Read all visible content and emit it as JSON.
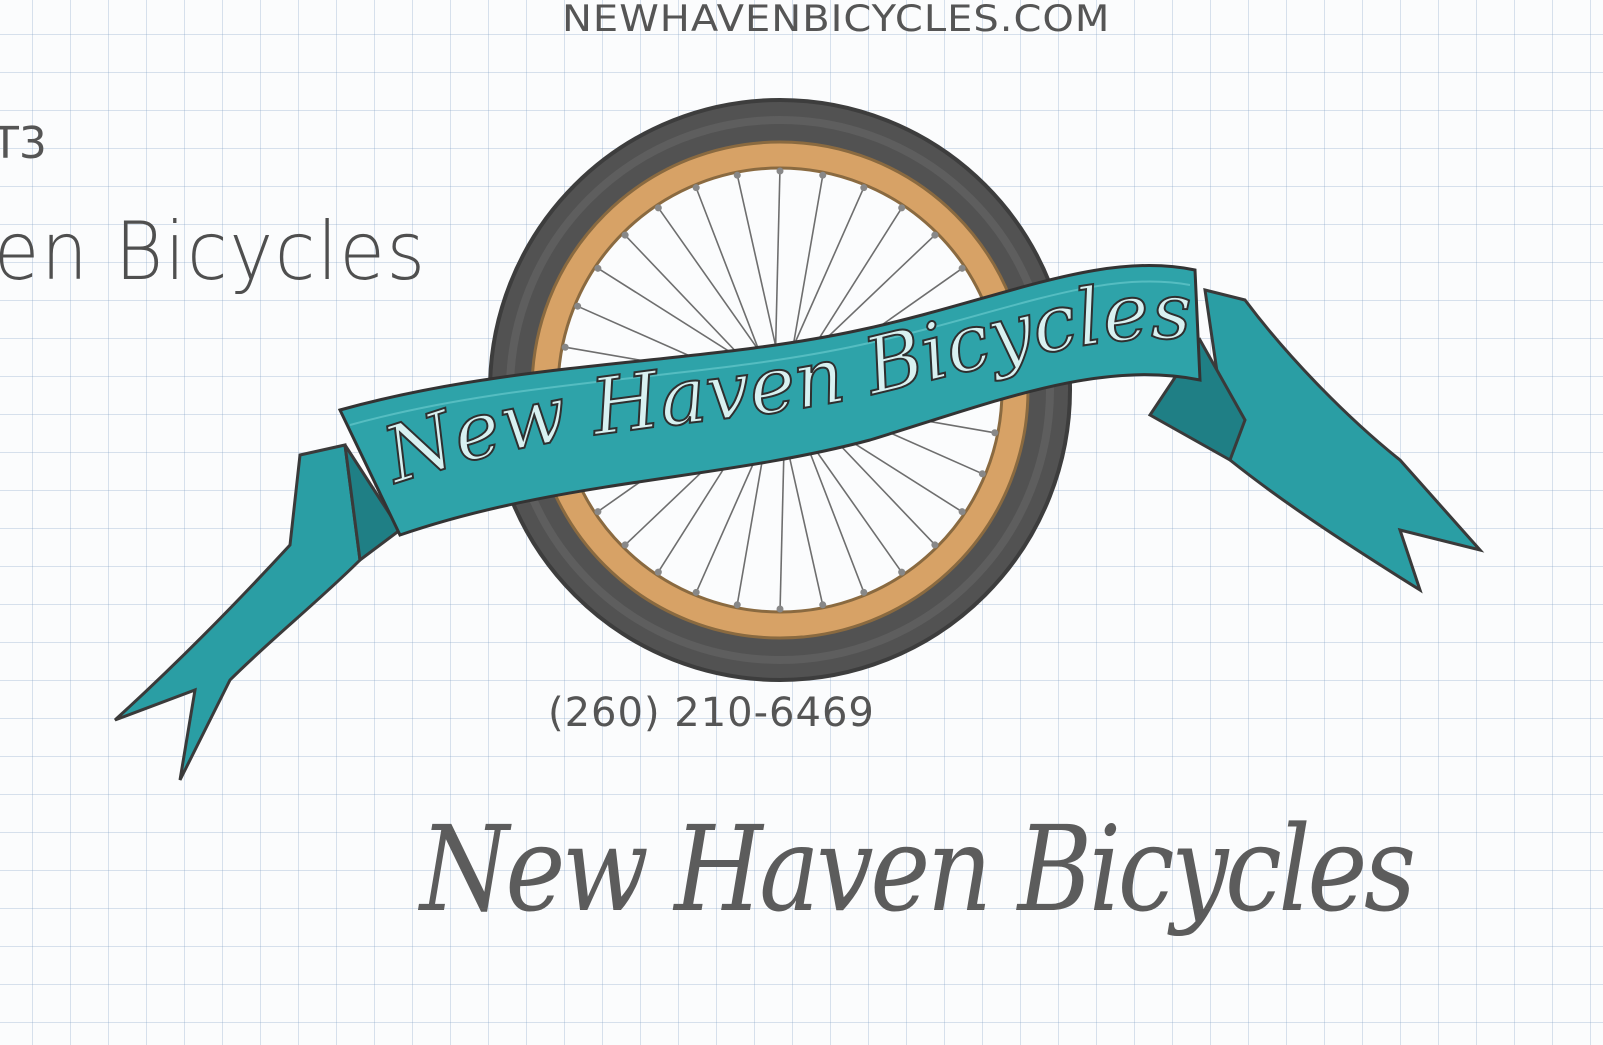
{
  "website_url": "NEWHAVENBICYCLES.COM",
  "top_right_scribble": "ᵕ ᵒ",
  "page_label": "T3",
  "partial_name": "en Bicycles",
  "banner_text": "New Haven Bicycles",
  "phone_number": "(260) 210-6469",
  "script_wordmark": "New Haven Bicycles",
  "colors": {
    "ribbon": "#2a9ea4",
    "rim": "#d09a5c",
    "tire": "#4a4a4a",
    "pencil": "#5a5a5a",
    "grid": "#9fb3cf"
  },
  "icons": [
    "bicycle-wheel-icon",
    "ribbon-banner-icon"
  ]
}
